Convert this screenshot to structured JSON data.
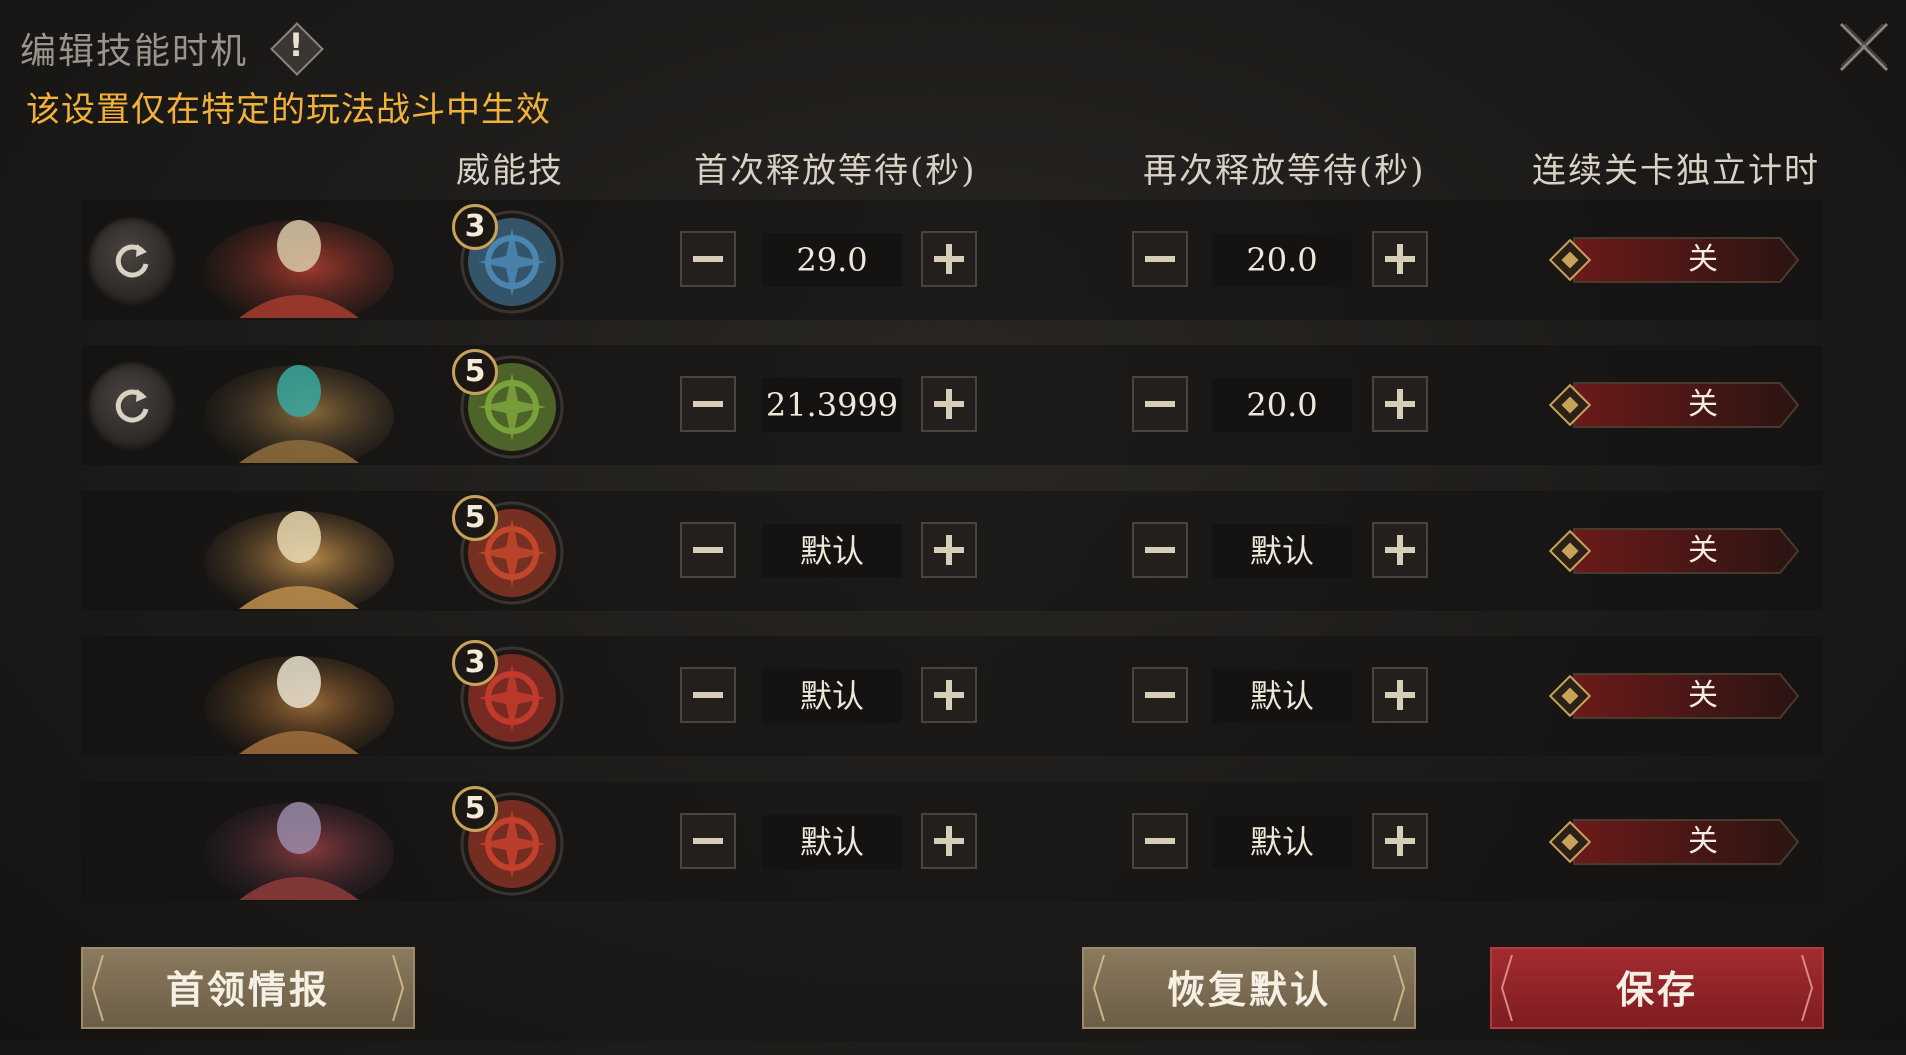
{
  "header": {
    "title": "编辑技能时机",
    "info_glyph": "!",
    "subtitle": "该设置仅在特定的玩法战斗中生效"
  },
  "columns": {
    "skill": "威能技",
    "first_wait": "首次释放等待(秒)",
    "second_wait": "再次释放等待(秒)",
    "stage_timer": "连续关卡独立计时"
  },
  "rows": [
    {
      "level": "3",
      "first": "29.0",
      "second": "20.0",
      "toggle": "关",
      "has_reset": true,
      "skill_color": "#4a86b0"
    },
    {
      "level": "5",
      "first": "21.3999",
      "second": "20.0",
      "toggle": "关",
      "has_reset": true,
      "skill_color": "#7aa23a"
    },
    {
      "level": "5",
      "first": "默认",
      "second": "默认",
      "toggle": "关",
      "has_reset": false,
      "skill_color": "#c2452c"
    },
    {
      "level": "3",
      "first": "默认",
      "second": "默认",
      "toggle": "关",
      "has_reset": false,
      "skill_color": "#c23a2c"
    },
    {
      "level": "5",
      "first": "默认",
      "second": "默认",
      "toggle": "关",
      "has_reset": false,
      "skill_color": "#c2402c"
    }
  ],
  "buttons": {
    "intel": "首领情报",
    "restore": "恢复默认",
    "save": "保存"
  },
  "icons": {
    "close": "close-x-icon",
    "reset": "refresh-icon",
    "minus": "minus-icon",
    "plus": "plus-icon"
  }
}
